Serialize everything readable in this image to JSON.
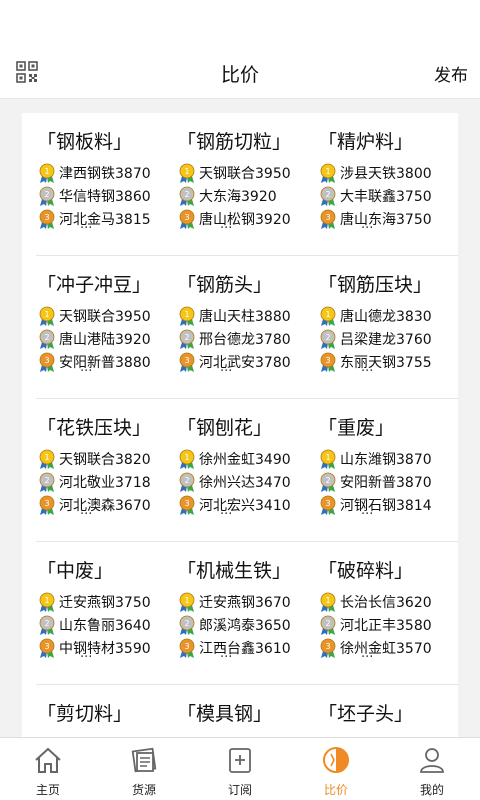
{
  "header": {
    "title": "比价",
    "publish_label": "发布"
  },
  "categories": [
    {
      "title": "「钢板料」",
      "items": [
        "津西钢铁3870",
        "华信特钢3860",
        "河北金马3815"
      ],
      "more": "..."
    },
    {
      "title": "「钢筋切粒」",
      "items": [
        "天钢联合3950",
        "大东海3920",
        "唐山松钢3920"
      ],
      "more": "..."
    },
    {
      "title": "「精炉料」",
      "items": [
        "涉县天铁3800",
        "大丰联鑫3750",
        "唐山东海3750"
      ],
      "more": "..."
    },
    {
      "title": "「冲子冲豆」",
      "items": [
        "天钢联合3950",
        "唐山港陆3920",
        "安阳新普3880"
      ],
      "more": "..."
    },
    {
      "title": "「钢筋头」",
      "items": [
        "唐山天柱3880",
        "邢台德龙3780",
        "河北武安3780"
      ],
      "more": "..."
    },
    {
      "title": "「钢筋压块」",
      "items": [
        "唐山德龙3830",
        "吕梁建龙3760",
        "东丽天钢3755"
      ],
      "more": "..."
    },
    {
      "title": "「花铁压块」",
      "items": [
        "天钢联合3820",
        "河北敬业3718",
        "河北澳森3670"
      ],
      "more": "..."
    },
    {
      "title": "「钢刨花」",
      "items": [
        "徐州金虹3490",
        "徐州兴达3470",
        "河北宏兴3410"
      ],
      "more": "..."
    },
    {
      "title": "「重废」",
      "items": [
        "山东潍钢3870",
        "安阳新普3870",
        "河钢石钢3814"
      ],
      "more": "..."
    },
    {
      "title": "「中废」",
      "items": [
        "迁安燕钢3750",
        "山东鲁丽3640",
        "中钢特材3590"
      ],
      "more": "..."
    },
    {
      "title": "「机械生铁」",
      "items": [
        "迁安燕钢3670",
        "郎溪鸿泰3650",
        "江西台鑫3610"
      ],
      "more": "..."
    },
    {
      "title": "「破碎料」",
      "items": [
        "长治长信3620",
        "河北正丰3580",
        "徐州金虹3570"
      ],
      "more": "..."
    },
    {
      "title": "「剪切料」",
      "items": [],
      "more": ""
    },
    {
      "title": "「模具钢」",
      "items": [],
      "more": ""
    },
    {
      "title": "「坯子头」",
      "items": [],
      "more": ""
    }
  ],
  "tabbar": [
    {
      "label": "主页",
      "icon": "home-icon"
    },
    {
      "label": "货源",
      "icon": "goods-icon"
    },
    {
      "label": "订阅",
      "icon": "subscribe-icon"
    },
    {
      "label": "比价",
      "icon": "compare-icon",
      "active": true
    },
    {
      "label": "我的",
      "icon": "profile-icon"
    }
  ],
  "colors": {
    "accent": "#f08a24",
    "gold": "#f5c518",
    "silver": "#c0c0c0",
    "bronze": "#e8942a"
  }
}
